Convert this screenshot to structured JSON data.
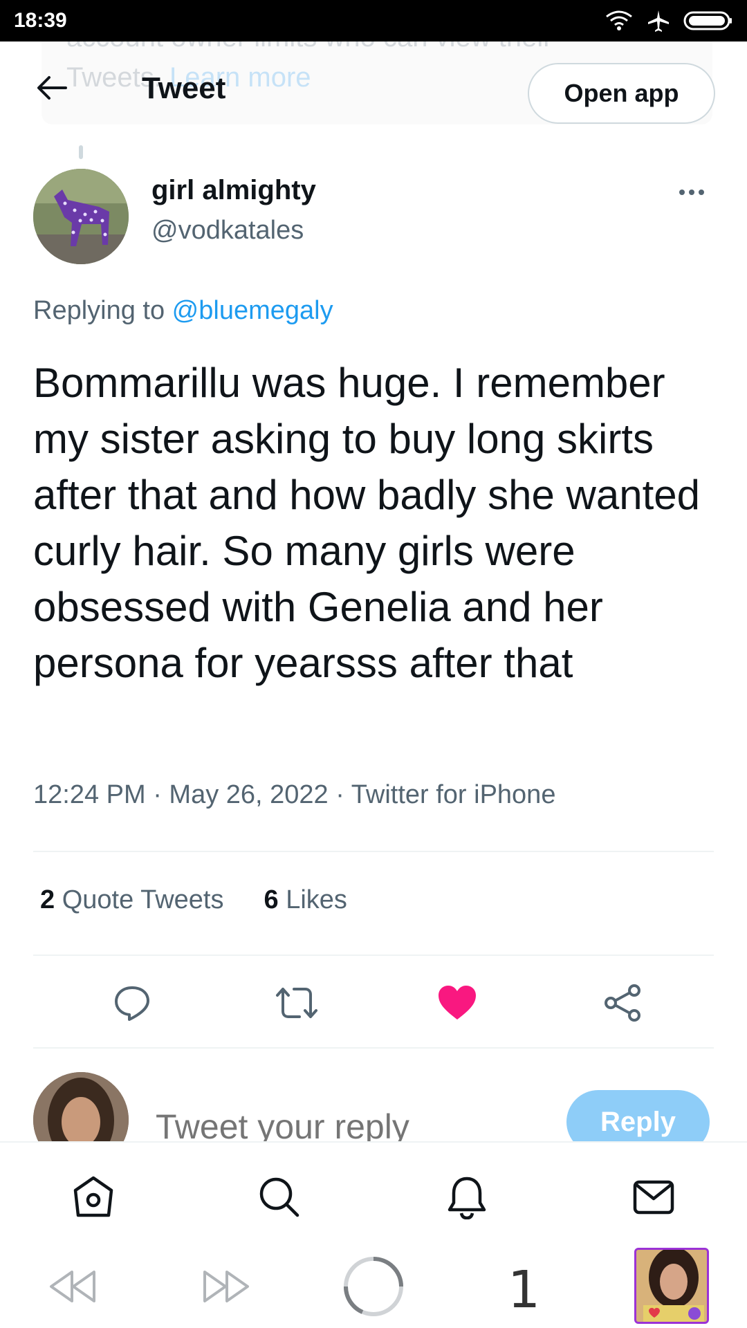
{
  "status_bar": {
    "time": "18:39",
    "icons": [
      "wifi-icon",
      "airplane-icon",
      "battery-icon"
    ]
  },
  "header": {
    "ghost_banner_line1": "account owner limits who can view their",
    "ghost_banner_line2_prefix": "Tweets. ",
    "ghost_banner_link": "Learn more",
    "title": "Tweet",
    "open_app_label": "Open app"
  },
  "tweet": {
    "author_name": "girl almighty",
    "author_handle": "@vodkatales",
    "replying_prefix": "Replying to ",
    "replying_to": "@bluemegaly",
    "text": "Bommarillu was huge. I remember my sister asking to buy long skirts after that and how badly she wanted curly hair. So many girls were obsessed with Genelia and her persona for yearsss after that",
    "meta": "12:24 PM · May 26, 2022 · Twitter for iPhone",
    "quote_tweets_count": "2",
    "quote_tweets_label": "Quote Tweets",
    "likes_count": "6",
    "likes_label": "Likes",
    "liked": true
  },
  "reply_box": {
    "placeholder": "Tweet your reply",
    "reply_label": "Reply"
  },
  "tab_bar": [
    "home-icon",
    "search-icon",
    "notifications-icon",
    "messages-icon"
  ],
  "browser_bar": {
    "tab_count": "1"
  },
  "colors": {
    "accent": "#1d9bf0",
    "like": "#f91880",
    "reply_button": "#8ecdf8",
    "secondary_text": "#536471",
    "primary_text": "#0f1419"
  }
}
